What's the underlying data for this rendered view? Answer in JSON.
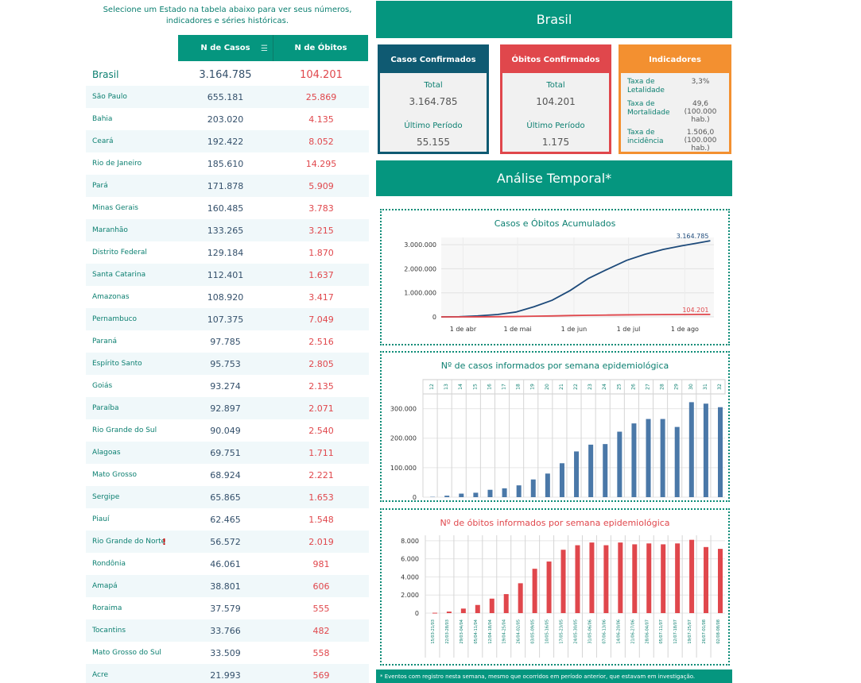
{
  "intro": "Selecione um Estado na tabela abaixo para ver seus números, indicadores e séries históricas.",
  "table": {
    "col_cases": "N de Casos",
    "col_deaths": "N de Óbitos",
    "sort_icon": "sort-icon",
    "rows": [
      {
        "name": "Brasil",
        "cases": "3.164.785",
        "deaths": "104.201"
      },
      {
        "name": "São Paulo",
        "cases": "655.181",
        "deaths": "25.869"
      },
      {
        "name": "Bahia",
        "cases": "203.020",
        "deaths": "4.135"
      },
      {
        "name": "Ceará",
        "cases": "192.422",
        "deaths": "8.052"
      },
      {
        "name": "Rio de Janeiro",
        "cases": "185.610",
        "deaths": "14.295"
      },
      {
        "name": "Pará",
        "cases": "171.878",
        "deaths": "5.909"
      },
      {
        "name": "Minas Gerais",
        "cases": "160.485",
        "deaths": "3.783"
      },
      {
        "name": "Maranhão",
        "cases": "133.265",
        "deaths": "3.215"
      },
      {
        "name": "Distrito Federal",
        "cases": "129.184",
        "deaths": "1.870"
      },
      {
        "name": "Santa Catarina",
        "cases": "112.401",
        "deaths": "1.637"
      },
      {
        "name": "Amazonas",
        "cases": "108.920",
        "deaths": "3.417"
      },
      {
        "name": "Pernambuco",
        "cases": "107.375",
        "deaths": "7.049"
      },
      {
        "name": "Paraná",
        "cases": "97.785",
        "deaths": "2.516"
      },
      {
        "name": "Espírito Santo",
        "cases": "95.753",
        "deaths": "2.805"
      },
      {
        "name": "Goiás",
        "cases": "93.274",
        "deaths": "2.135"
      },
      {
        "name": "Paraíba",
        "cases": "92.897",
        "deaths": "2.071"
      },
      {
        "name": "Rio Grande do Sul",
        "cases": "90.049",
        "deaths": "2.540"
      },
      {
        "name": "Alagoas",
        "cases": "69.751",
        "deaths": "1.711"
      },
      {
        "name": "Mato Grosso",
        "cases": "68.924",
        "deaths": "2.221"
      },
      {
        "name": "Sergipe",
        "cases": "65.865",
        "deaths": "1.653"
      },
      {
        "name": "Piauí",
        "cases": "62.465",
        "deaths": "1.548"
      },
      {
        "name": "Rio Grande do Norte",
        "cases": "56.572",
        "deaths": "2.019",
        "warn": "!"
      },
      {
        "name": "Rondônia",
        "cases": "46.061",
        "deaths": "981"
      },
      {
        "name": "Amapá",
        "cases": "38.801",
        "deaths": "606"
      },
      {
        "name": "Roraima",
        "cases": "37.579",
        "deaths": "555"
      },
      {
        "name": "Tocantins",
        "cases": "33.766",
        "deaths": "482"
      },
      {
        "name": "Mato Grosso do Sul",
        "cases": "33.509",
        "deaths": "558"
      },
      {
        "name": "Acre",
        "cases": "21.993",
        "deaths": "569"
      }
    ]
  },
  "header": {
    "title": "Brasil",
    "analysis_title": "Análise Temporal*"
  },
  "cards": {
    "cases": {
      "title": "Casos Confirmados",
      "total_label": "Total",
      "total": "3.164.785",
      "period_label": "Último Período",
      "period": "55.155"
    },
    "deaths": {
      "title": "Óbitos Confirmados",
      "total_label": "Total",
      "total": "104.201",
      "period_label": "Último Período",
      "period": "1.175"
    },
    "indicators": {
      "title": "Indicadores",
      "items": [
        {
          "label": "Taxa de Letalidade",
          "value": "3,3%"
        },
        {
          "label": "Taxa de Mortalidade",
          "value": "49,6 (100.000 hab.)"
        },
        {
          "label": "Taxa de incidência",
          "value": "1.506,0 (100.000 hab.)"
        }
      ]
    }
  },
  "colors": {
    "teal": "#05967f",
    "navy": "#0f5a72",
    "red": "#e0474c",
    "orange": "#f39030",
    "blue_bar": "#4a78a8"
  },
  "chart_data": [
    {
      "type": "line",
      "title": "Casos e Óbitos Acumulados",
      "x_ticks": [
        "1 de abr",
        "1 de mai",
        "1 de jun",
        "1 de jul",
        "1 de ago"
      ],
      "y_ticks": [
        "0",
        "1.000.000",
        "2.000.000",
        "3.000.000"
      ],
      "ylim": [
        0,
        3300000
      ],
      "x_days": [
        0,
        10,
        20,
        31,
        41,
        51,
        61,
        71,
        81,
        92,
        102,
        112,
        122,
        132,
        142,
        148
      ],
      "series": [
        {
          "name": "Casos",
          "end_label": "3.164.785",
          "values": [
            0,
            8000,
            40000,
            100000,
            200000,
            420000,
            690000,
            1100000,
            1600000,
            2000000,
            2350000,
            2600000,
            2800000,
            2950000,
            3080000,
            3164785
          ]
        },
        {
          "name": "Óbitos",
          "end_label": "104.201",
          "values": [
            0,
            300,
            2000,
            7000,
            14000,
            28000,
            40000,
            55000,
            65000,
            76000,
            84000,
            90000,
            95000,
            99000,
            102000,
            104201
          ]
        }
      ]
    },
    {
      "type": "bar",
      "title": "Nº de casos informados por semana epidemiológica",
      "categories": [
        "12",
        "13",
        "14",
        "15",
        "16",
        "17",
        "18",
        "19",
        "20",
        "21",
        "22",
        "23",
        "24",
        "25",
        "26",
        "27",
        "28",
        "29",
        "30",
        "31",
        "32"
      ],
      "values": [
        1000,
        5000,
        12000,
        15000,
        25000,
        30000,
        40000,
        60000,
        80000,
        115000,
        155000,
        178000,
        180000,
        222000,
        250000,
        265000,
        265000,
        238000,
        322000,
        317000,
        305000
      ],
      "y_ticks": [
        "0",
        "100.000",
        "200.000",
        "300.000"
      ],
      "ylim": [
        0,
        350000
      ]
    },
    {
      "type": "bar",
      "title": "Nº de óbitos informados por semana epidemiológica",
      "categories": [
        "15/03-21/03",
        "22/03-28/03",
        "29/03-04/04",
        "05/04-11/04",
        "12/04-18/04",
        "19/04-25/04",
        "26/04-02/05",
        "03/05-09/05",
        "10/05-16/05",
        "17/05-23/05",
        "24/05-30/05",
        "31/05-06/06",
        "07/06-13/06",
        "14/06-20/06",
        "21/06-27/06",
        "28/06-04/07",
        "05/07-11/07",
        "12/07-18/07",
        "19/07-25/07",
        "26/07-01/08",
        "02/08-08/08"
      ],
      "values": [
        40,
        170,
        500,
        900,
        1600,
        2100,
        3300,
        4900,
        5700,
        7000,
        7500,
        7800,
        7500,
        7800,
        7600,
        7700,
        7600,
        7700,
        8100,
        7300,
        7100
      ],
      "y_ticks": [
        "0",
        "2.000",
        "4.000",
        "6.000",
        "8.000"
      ],
      "ylim": [
        0,
        8600
      ]
    }
  ],
  "footer": "* Eventos com registro nesta semana, mesmo que ocorridos em período anterior, que estavam em investigação."
}
